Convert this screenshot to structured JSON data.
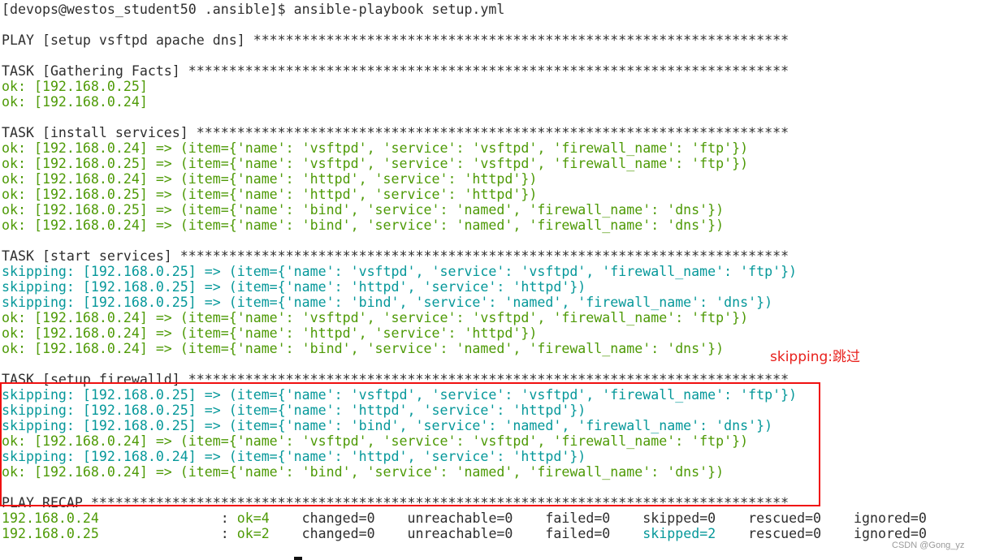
{
  "colors": {
    "green": "#4e9a06",
    "cyan": "#06989a",
    "annotation": "#e8201c"
  },
  "terminal": {
    "lines": [
      [
        {
          "t": "[devops@westos_student50 .ansible]$ ansible-playbook setup.yml",
          "c": "default"
        }
      ],
      [],
      [
        {
          "t": "PLAY [setup vsftpd apache dns] ******************************************************************",
          "c": "default"
        }
      ],
      [],
      [
        {
          "t": "TASK [Gathering Facts] **************************************************************************",
          "c": "default"
        }
      ],
      [
        {
          "t": "ok: [192.168.0.25]",
          "c": "green"
        }
      ],
      [
        {
          "t": "ok: [192.168.0.24]",
          "c": "green"
        }
      ],
      [],
      [
        {
          "t": "TASK [install services] *************************************************************************",
          "c": "default"
        }
      ],
      [
        {
          "t": "ok: [192.168.0.24] => (item={'name': 'vsftpd', 'service': 'vsftpd', 'firewall_name': 'ftp'})",
          "c": "green"
        }
      ],
      [
        {
          "t": "ok: [192.168.0.25] => (item={'name': 'vsftpd', 'service': 'vsftpd', 'firewall_name': 'ftp'})",
          "c": "green"
        }
      ],
      [
        {
          "t": "ok: [192.168.0.24] => (item={'name': 'httpd', 'service': 'httpd'})",
          "c": "green"
        }
      ],
      [
        {
          "t": "ok: [192.168.0.25] => (item={'name': 'httpd', 'service': 'httpd'})",
          "c": "green"
        }
      ],
      [
        {
          "t": "ok: [192.168.0.25] => (item={'name': 'bind', 'service': 'named', 'firewall_name': 'dns'})",
          "c": "green"
        }
      ],
      [
        {
          "t": "ok: [192.168.0.24] => (item={'name': 'bind', 'service': 'named', 'firewall_name': 'dns'})",
          "c": "green"
        }
      ],
      [],
      [
        {
          "t": "TASK [start services] ***************************************************************************",
          "c": "default"
        }
      ],
      [
        {
          "t": "skipping: [192.168.0.25] => (item={'name': 'vsftpd', 'service': 'vsftpd', 'firewall_name': 'ftp'})",
          "c": "cyan"
        }
      ],
      [
        {
          "t": "skipping: [192.168.0.25] => (item={'name': 'httpd', 'service': 'httpd'})",
          "c": "cyan"
        }
      ],
      [
        {
          "t": "skipping: [192.168.0.25] => (item={'name': 'bind', 'service': 'named', 'firewall_name': 'dns'})",
          "c": "cyan"
        }
      ],
      [
        {
          "t": "ok: [192.168.0.24] => (item={'name': 'vsftpd', 'service': 'vsftpd', 'firewall_name': 'ftp'})",
          "c": "green"
        }
      ],
      [
        {
          "t": "ok: [192.168.0.24] => (item={'name': 'httpd', 'service': 'httpd'})",
          "c": "green"
        }
      ],
      [
        {
          "t": "ok: [192.168.0.24] => (item={'name': 'bind', 'service': 'named', 'firewall_name': 'dns'})",
          "c": "green"
        }
      ],
      [],
      [
        {
          "t": "TASK [setup firewalld] **************************************************************************",
          "c": "default"
        }
      ],
      [
        {
          "t": "skipping: [192.168.0.25] => (item={'name': 'vsftpd', 'service': 'vsftpd', 'firewall_name': 'ftp'})",
          "c": "cyan"
        }
      ],
      [
        {
          "t": "skipping: [192.168.0.25] => (item={'name': 'httpd', 'service': 'httpd'})",
          "c": "cyan"
        }
      ],
      [
        {
          "t": "skipping: [192.168.0.25] => (item={'name': 'bind', 'service': 'named', 'firewall_name': 'dns'})",
          "c": "cyan"
        }
      ],
      [
        {
          "t": "ok: [192.168.0.24] => (item={'name': 'vsftpd', 'service': 'vsftpd', 'firewall_name': 'ftp'})",
          "c": "green"
        }
      ],
      [
        {
          "t": "skipping: [192.168.0.24] => (item={'name': 'httpd', 'service': 'httpd'})",
          "c": "cyan"
        }
      ],
      [
        {
          "t": "ok: [192.168.0.24] => (item={'name': 'bind', 'service': 'named', 'firewall_name': 'dns'})",
          "c": "green"
        }
      ],
      [],
      [
        {
          "t": "PLAY RECAP **************************************************************************************",
          "c": "default"
        }
      ],
      [
        {
          "t": "192.168.0.24",
          "c": "green"
        },
        {
          "t": "               : ",
          "c": "default"
        },
        {
          "t": "ok=4",
          "c": "green"
        },
        {
          "t": "    changed=0    unreachable=0    failed=0    skipped=0    rescued=0    ignored=0",
          "c": "default"
        }
      ],
      [
        {
          "t": "192.168.0.25",
          "c": "green"
        },
        {
          "t": "               : ",
          "c": "default"
        },
        {
          "t": "ok=2",
          "c": "green"
        },
        {
          "t": "    changed=0    unreachable=0    failed=0    ",
          "c": "default"
        },
        {
          "t": "skipped=2",
          "c": "cyan"
        },
        {
          "t": "    rescued=0    ignored=0",
          "c": "default"
        }
      ]
    ]
  },
  "annotation": {
    "text": "skipping:跳过"
  },
  "watermark": {
    "text": "CSDN @Gong_yz"
  }
}
